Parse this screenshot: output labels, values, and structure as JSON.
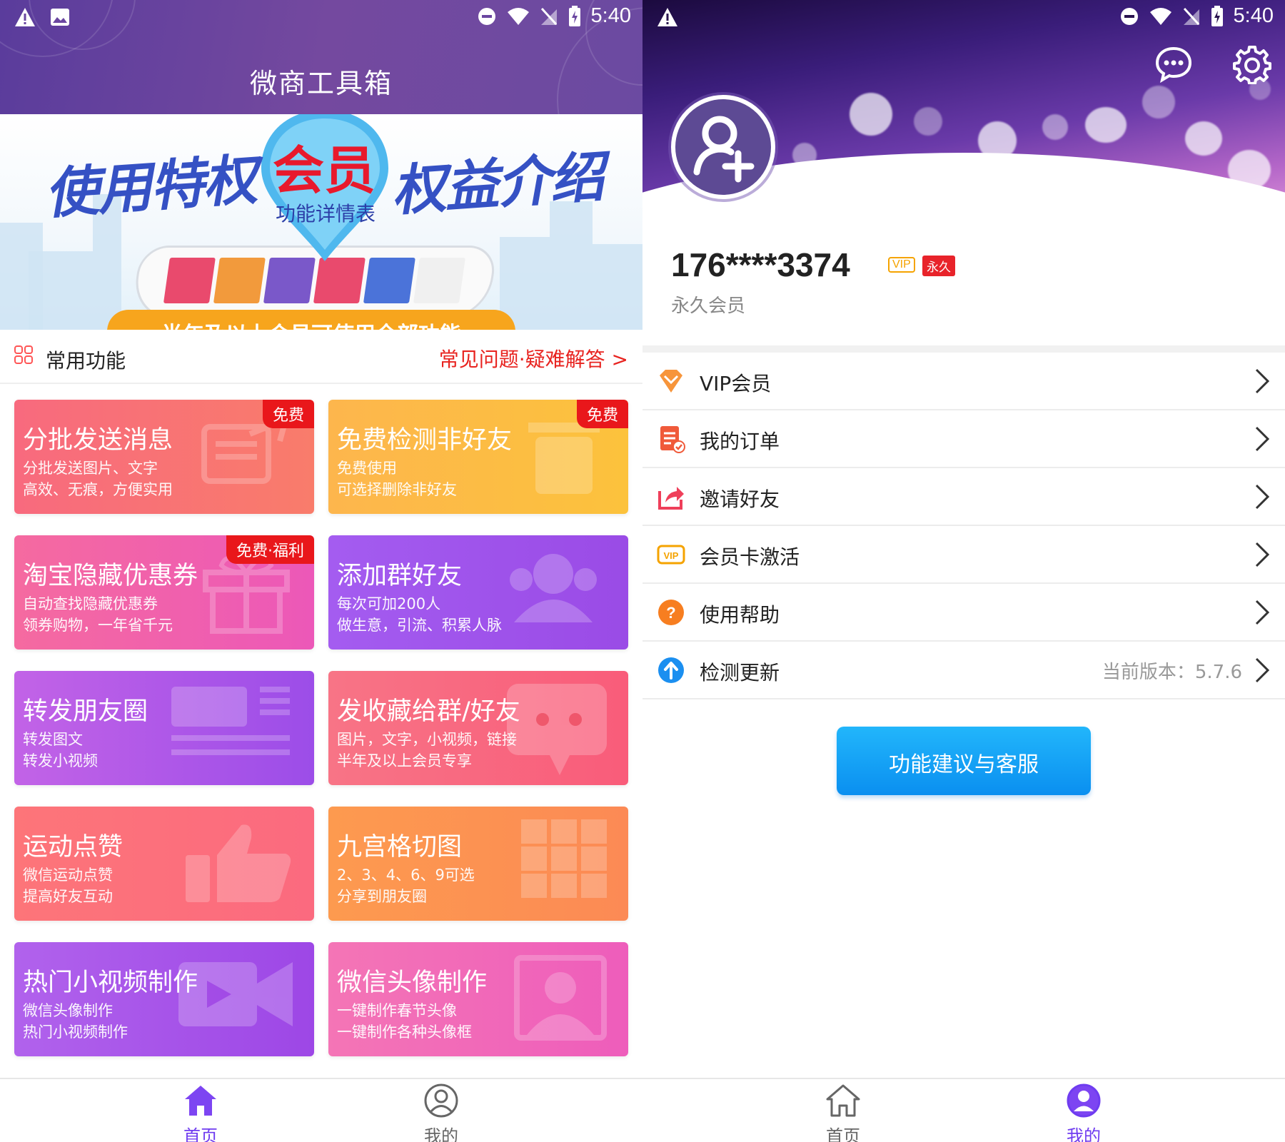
{
  "status_bar": {
    "time": "5:40"
  },
  "left": {
    "app_title": "微商工具箱",
    "banner": {
      "text_left": "使用特权",
      "text_center": "会员",
      "text_right": "权益介绍",
      "text_sub": "功能详情表",
      "text_strip": "半年及以上会员可使用全部功能"
    },
    "section": {
      "title": "常用功能",
      "link": "常见问题·疑难解答 >"
    },
    "cards": [
      {
        "title": "分批发送消息",
        "line1": "分批发送图片、文字",
        "line2": "高效、无痕，方便实用",
        "badge": "免费",
        "icon": "message-batch-icon",
        "gradient": [
          "#f86a7e",
          "#f97c6b"
        ]
      },
      {
        "title": "免费检测非好友",
        "line1": "免费使用",
        "line2": "可选择删除非好友",
        "badge": "免费",
        "icon": "trash-icon",
        "gradient": [
          "#fdb64d",
          "#fcc23c"
        ]
      },
      {
        "title": "淘宝隐藏优惠券",
        "line1": "自动查找隐藏优惠券",
        "line2": "领券购物，一年省千元",
        "badge": "免费·福利",
        "icon": "gift-icon",
        "gradient": [
          "#f56aa0",
          "#ec58b8"
        ]
      },
      {
        "title": "添加群好友",
        "line1": "每次可加200人",
        "line2": "做生意，引流、积累人脉",
        "badge": "",
        "icon": "group-users-icon",
        "gradient": [
          "#a45cf0",
          "#9a4be6"
        ]
      },
      {
        "title": "转发朋友圈",
        "line1": "转发图文",
        "line2": "转发小视频",
        "badge": "",
        "icon": "moments-post-icon",
        "gradient": [
          "#c263e7",
          "#9c4de8"
        ]
      },
      {
        "title": "发收藏给群/好友",
        "line1": "图片，文字，小视频，链接",
        "line2": "半年及以上会员专享",
        "badge": "",
        "icon": "chat-bubble-icon",
        "gradient": [
          "#f87486",
          "#f95c7a"
        ]
      },
      {
        "title": "运动点赞",
        "line1": "微信运动点赞",
        "line2": "提高好友互动",
        "badge": "",
        "icon": "thumbs-up-icon",
        "gradient": [
          "#fd7579",
          "#fb6a7f"
        ]
      },
      {
        "title": "九宫格切图",
        "line1": "2、3、4、6、9可选",
        "line2": "分享到朋友圈",
        "badge": "",
        "icon": "grid-icon",
        "gradient": [
          "#fd9a4f",
          "#fc8a55"
        ]
      },
      {
        "title": "热门小视频制作",
        "line1": "微信头像制作",
        "line2": "热门小视频制作",
        "badge": "",
        "icon": "video-camera-icon",
        "gradient": [
          "#b162ec",
          "#9d47e6"
        ]
      },
      {
        "title": "微信头像制作",
        "line1": "一键制作春节头像",
        "line2": "一键制作各种头像框",
        "badge": "",
        "icon": "portrait-icon",
        "gradient": [
          "#f475b6",
          "#ee5dbb"
        ]
      }
    ],
    "nav": [
      {
        "label": "首页",
        "icon": "home-icon",
        "active": true
      },
      {
        "label": "我的",
        "icon": "profile-icon",
        "active": false
      }
    ]
  },
  "right": {
    "phone": "176****3374",
    "vip_badge": "VIP",
    "forever_badge": "永久",
    "member_text": "永久会员",
    "menu": [
      {
        "label": "VIP会员",
        "icon": "diamond-icon",
        "extra": ""
      },
      {
        "label": "我的订单",
        "icon": "order-icon",
        "extra": ""
      },
      {
        "label": "邀请好友",
        "icon": "share-icon",
        "extra": ""
      },
      {
        "label": "会员卡激活",
        "icon": "vip-card-icon",
        "extra": ""
      },
      {
        "label": "使用帮助",
        "icon": "help-icon",
        "extra": ""
      },
      {
        "label": "检测更新",
        "icon": "update-icon",
        "extra": "当前版本：5.7.6"
      }
    ],
    "service_button": "功能建议与客服",
    "nav": [
      {
        "label": "首页",
        "icon": "home-icon",
        "active": false
      },
      {
        "label": "我的",
        "icon": "profile-icon",
        "active": true
      }
    ]
  },
  "colors": {
    "accent_purple": "#6f3cf0",
    "link_red": "#e8231f",
    "service_blue": "#1aa3f7",
    "inactive_gray": "#666666"
  }
}
